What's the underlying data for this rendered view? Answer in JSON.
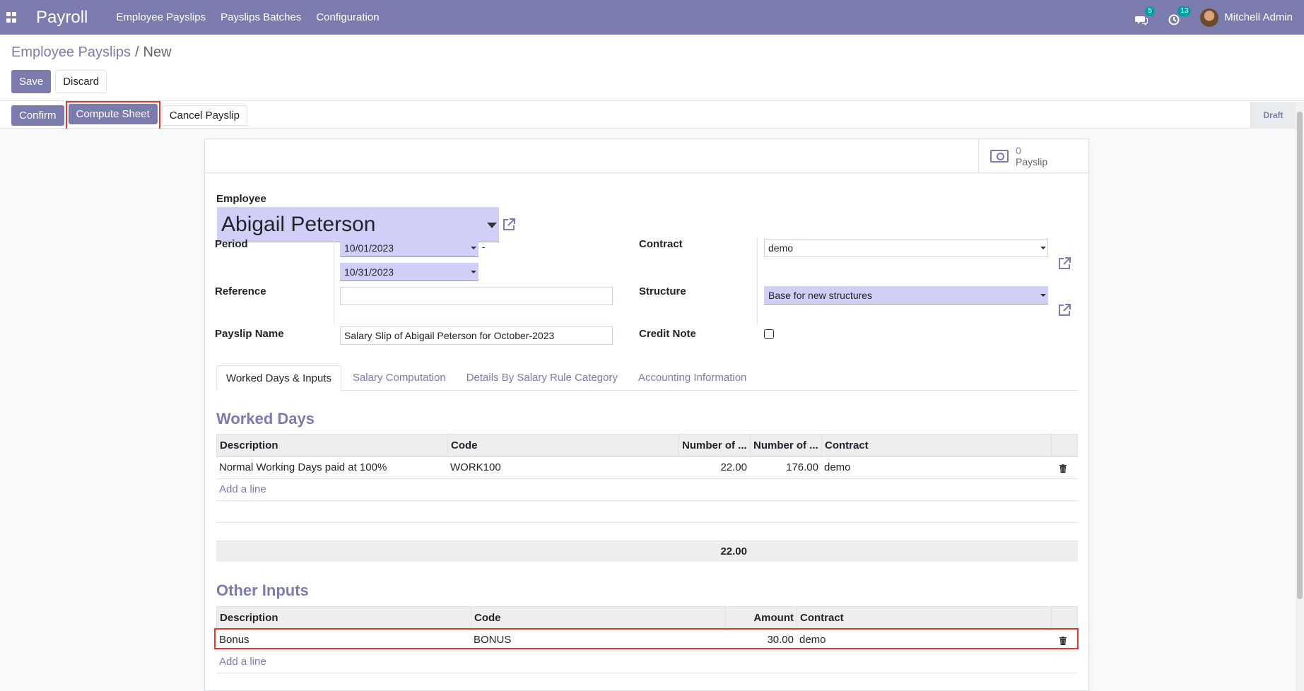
{
  "navbar": {
    "app_title": "Payroll",
    "menu": [
      "Employee Payslips",
      "Payslips Batches",
      "Configuration"
    ],
    "messages_count": "5",
    "activities_count": "13",
    "user_name": "Mitchell Admin"
  },
  "breadcrumb": {
    "parent": "Employee Payslips",
    "separator": "/",
    "current": "New"
  },
  "control": {
    "save_label": "Save",
    "discard_label": "Discard"
  },
  "statusbar": {
    "confirm_label": "Confirm",
    "compute_label": "Compute Sheet",
    "cancel_label": "Cancel Payslip",
    "stage": "Draft"
  },
  "stat_button": {
    "value": "0",
    "label": "Payslip"
  },
  "form": {
    "employee_label": "Employee",
    "employee_value": "Abigail Peterson",
    "period_label": "Period",
    "period_from": "10/01/2023",
    "period_sep": "-",
    "period_to": "10/31/2023",
    "reference_label": "Reference",
    "reference_value": "",
    "payslip_name_label": "Payslip Name",
    "payslip_name_value": "Salary Slip of Abigail Peterson for October-2023",
    "contract_label": "Contract",
    "contract_value": "demo",
    "structure_label": "Structure",
    "structure_value": "Base for new structures",
    "credit_note_label": "Credit Note"
  },
  "tabs": [
    "Worked Days & Inputs",
    "Salary Computation",
    "Details By Salary Rule Category",
    "Accounting Information"
  ],
  "worked_days": {
    "title": "Worked Days",
    "columns": [
      "Description",
      "Code",
      "Number of ...",
      "Number of ...",
      "Contract"
    ],
    "rows": [
      {
        "description": "Normal Working Days paid at 100%",
        "code": "WORK100",
        "days": "22.00",
        "hours": "176.00",
        "contract": "demo"
      }
    ],
    "add_line": "Add a line",
    "total": "22.00"
  },
  "other_inputs": {
    "title": "Other Inputs",
    "columns": [
      "Description",
      "Code",
      "Amount",
      "Contract"
    ],
    "rows": [
      {
        "description": "Bonus",
        "code": "BONUS",
        "amount": "30.00",
        "contract": "demo"
      }
    ],
    "add_line": "Add a line"
  }
}
